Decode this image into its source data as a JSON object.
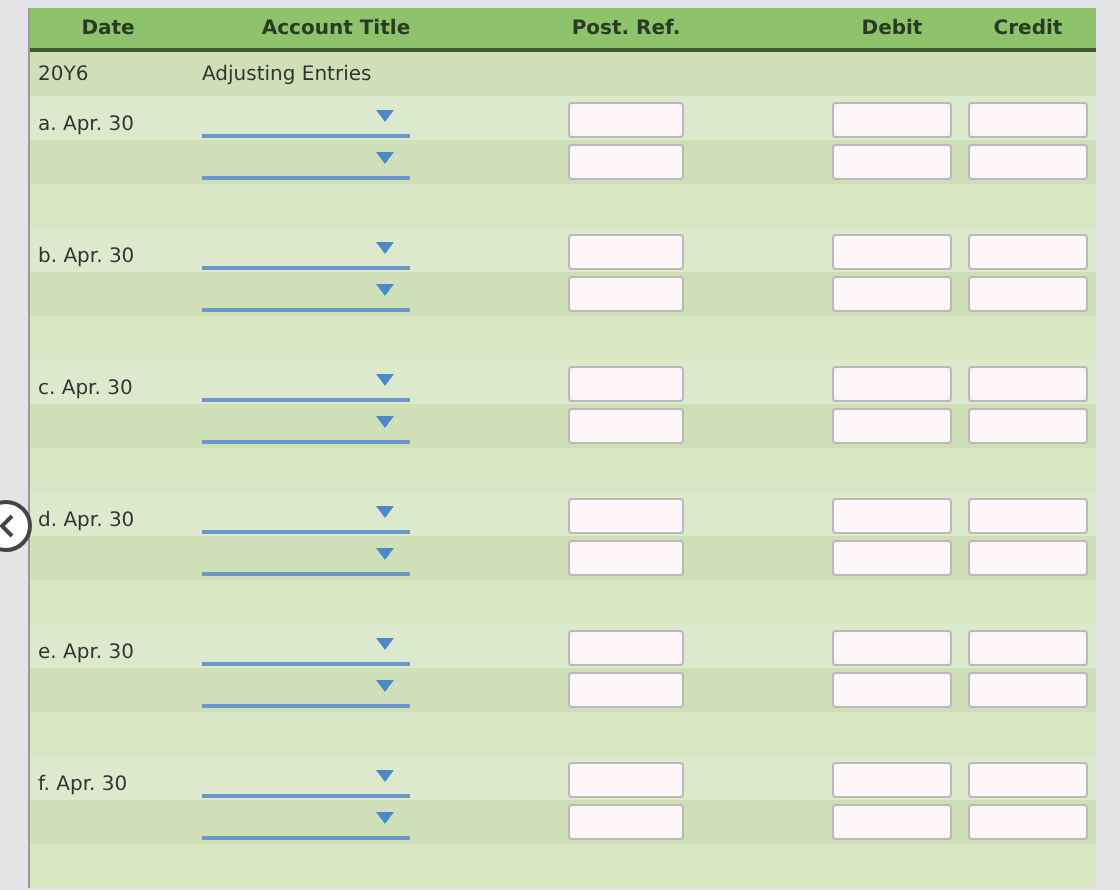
{
  "columns": [
    "Date",
    "Account Title",
    "Post. Ref.",
    "Debit",
    "Credit"
  ],
  "year_row": {
    "date": "20Y6",
    "account_title": "Adjusting Entries"
  },
  "entries": [
    {
      "date": "a. Apr. 30"
    },
    {
      "date": "b. Apr. 30"
    },
    {
      "date": "c. Apr. 30"
    },
    {
      "date": "d. Apr. 30"
    },
    {
      "date": "e. Apr. 30"
    },
    {
      "date": "f. Apr. 30"
    }
  ]
}
